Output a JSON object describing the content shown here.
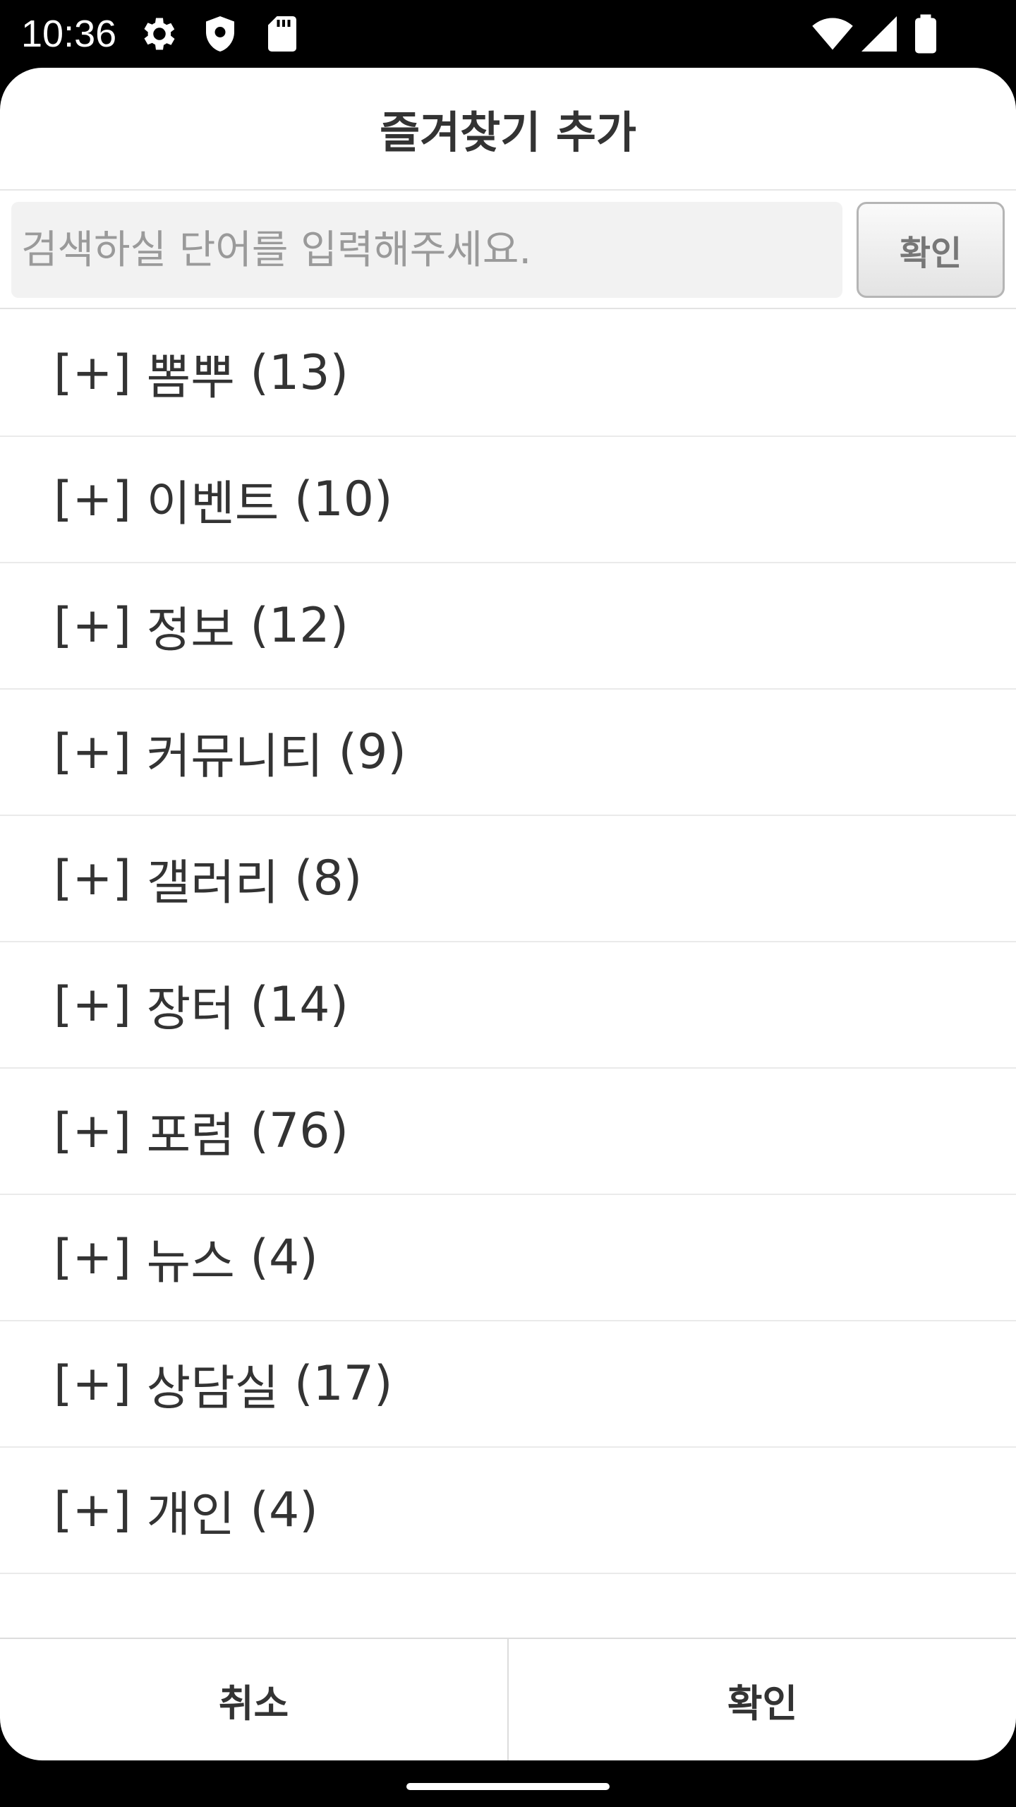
{
  "status_bar": {
    "time": "10:36",
    "left_icons": [
      "gear-icon",
      "shield-icon",
      "sd-card-icon"
    ],
    "right_icons": [
      "wifi-icon",
      "signal-icon",
      "battery-icon"
    ]
  },
  "dialog": {
    "title": "즐겨찾기 추가",
    "search": {
      "placeholder": "검색하실 단어를 입력해주세요.",
      "value": "",
      "button_label": "확인"
    },
    "boards": [
      {
        "prefix": "[+]",
        "name": "뽐뿌",
        "count": "(13)"
      },
      {
        "prefix": "[+]",
        "name": "이벤트",
        "count": "(10)"
      },
      {
        "prefix": "[+]",
        "name": "정보",
        "count": "(12)"
      },
      {
        "prefix": "[+]",
        "name": "커뮤니티",
        "count": "(9)"
      },
      {
        "prefix": "[+]",
        "name": "갤러리",
        "count": "(8)"
      },
      {
        "prefix": "[+]",
        "name": "장터",
        "count": "(14)"
      },
      {
        "prefix": "[+]",
        "name": "포럼",
        "count": "(76)"
      },
      {
        "prefix": "[+]",
        "name": "뉴스",
        "count": "(4)"
      },
      {
        "prefix": "[+]",
        "name": "상담실",
        "count": "(17)"
      },
      {
        "prefix": "[+]",
        "name": "개인",
        "count": "(4)"
      }
    ],
    "footer": {
      "cancel_label": "취소",
      "confirm_label": "확인"
    }
  },
  "colors": {
    "background": "#000000",
    "dialog": "#ffffff",
    "text": "#333333",
    "placeholder": "#9a9a9a"
  }
}
